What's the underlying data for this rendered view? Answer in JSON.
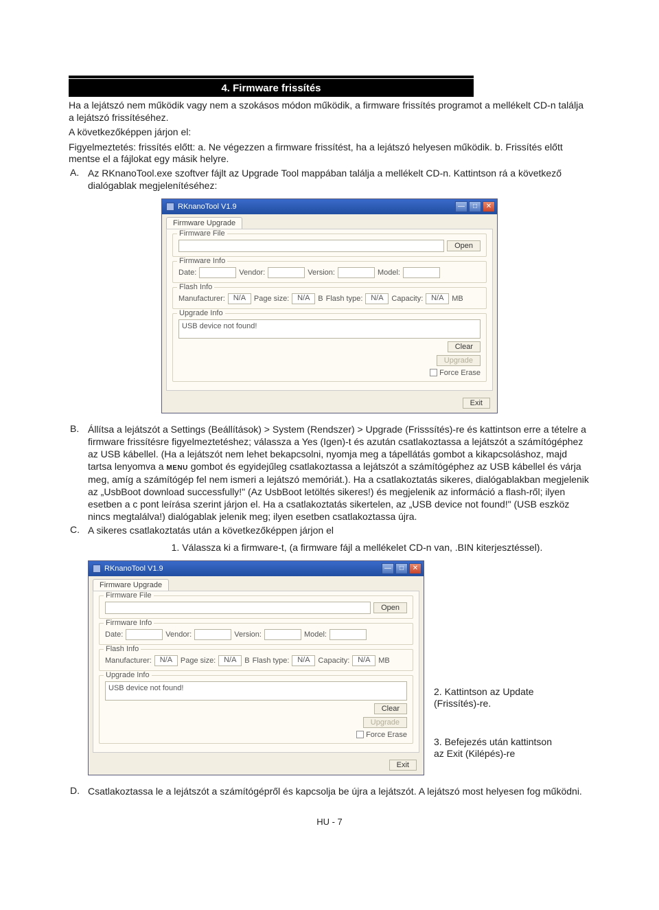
{
  "header": {
    "title": "4. Firmware frissítés"
  },
  "intro": {
    "p1": "Ha a lejátszó nem működik vagy nem a szokásos módon működik, a firmware frissítés programot a mellékelt CD-n találja a lejátszó frissítéséhez.",
    "p2": "A következőképpen járjon el:",
    "p3": "Figyelmeztetés: frissítés előtt: a. Ne végezzen a firmware frissítést, ha a lejátszó helyesen működik. b. Frissítés előtt mentse el a fájlokat egy másik helyre."
  },
  "itemA": {
    "letter": "A.",
    "text": "Az RKnanoTool.exe szoftver fájlt az Upgrade Tool mappában találja a mellékelt CD-n. Kattintson rá a következő dialógablak megjelenítéséhez:"
  },
  "itemB": {
    "letter": "B.",
    "text_a": "Állítsa a lejátszót a Settings (Beállítások) > System (Rendszer) > Upgrade (Frisssítés)-re és kattintson erre a tételre a firmware frissítésre figyelmeztetéshez; válassza a Yes (Igen)-t és azután csatlakoztassa a lejátszót a számítógéphez az USB kábellel. (Ha a lejátszót nem lehet bekapcsolni, nyomja meg a tápellátás gombot a kikapcsoláshoz, majd tartsa lenyomva a ",
    "menu": "MENU",
    "text_b": " gombot és egyidejűleg csatlakoztassa a lejátszót a számítógéphez az USB kábellel és várja meg, amíg a számítógép fel nem ismeri a lejátszó memóriát.). Ha a csatlakoztatás sikeres, dialógablakban megjelenik az „UsbBoot download successfully!\" (Az UsbBoot letöltés sikeres!) és megjelenik az információ a flash-ről; ilyen esetben a c pont leírása szerint járjon el. Ha a csatlakoztatás sikertelen, az „USB device not found!\" (USB eszköz nincs megtalálva!) dialógablak jelenik meg; ilyen esetben csatlakoztassa újra."
  },
  "itemC": {
    "letter": "C.",
    "text": "A sikeres csatlakoztatás után a következőképpen járjon el",
    "note1": "1. Válassza ki a firmware-t, (a firmware fájl a mellékelet CD-n van, .BIN kiterjesztéssel)."
  },
  "annot": {
    "a2": "2. Kattintson az Update (Frissítés)-re.",
    "a3": "3. Befejezés után kattintson az Exit (Kilépés)-re"
  },
  "itemD": {
    "letter": "D.",
    "text": "Csatlakoztassa le a lejátszót a számítógépről és kapcsolja be újra a lejátszót. A lejátszó most helyesen fog működni."
  },
  "dialog": {
    "title": "RKnanoTool V1.9",
    "tab": "Firmware Upgrade",
    "firmware_file": "Firmware File",
    "open": "Open",
    "firmware_info": "Firmware Info",
    "date": "Date:",
    "vendor": "Vendor:",
    "version": "Version:",
    "model": "Model:",
    "flash_info": "Flash Info",
    "manufacturer": "Manufacturer:",
    "na": "N/A",
    "page_size": "Page size:",
    "b": "B",
    "flash_type": "Flash type:",
    "capacity": "Capacity:",
    "mb": "MB",
    "upgrade_info": "Upgrade Info",
    "usb_not_found": "USB device not found!",
    "clear": "Clear",
    "upgrade": "Upgrade",
    "force_erase": "Force Erase",
    "exit": "Exit"
  },
  "footer": "HU - 7"
}
